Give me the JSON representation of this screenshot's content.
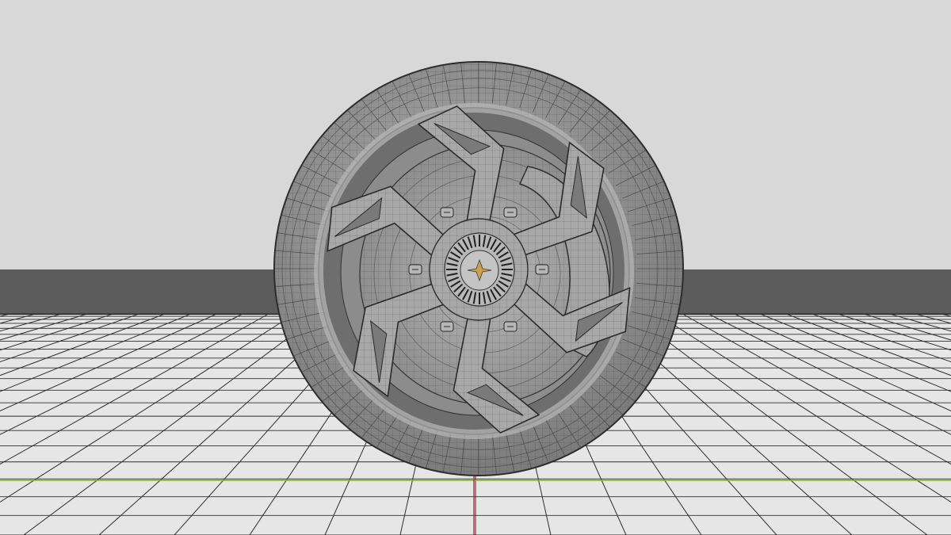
{
  "viewport": {
    "background_color": "#d8d8d8",
    "horizon_band_color": "#5c5c5c",
    "floor_color": "#e6e6e6",
    "grid_line_color": "#2e2e2e",
    "x_axis_color": "#7fb02e",
    "y_axis_color": "#c0283c"
  },
  "wheel": {
    "spoke_count": 6,
    "caliper_count": 1,
    "lug_count": 6,
    "tire_color": "#9a9a9a",
    "rim_color": "#b4b4b4",
    "spoke_color": "#a8a8a8",
    "disc_color": "#a0a0a0",
    "wire_color": "#3a3a3a",
    "hub_emblem_color": "#c9a24a"
  }
}
